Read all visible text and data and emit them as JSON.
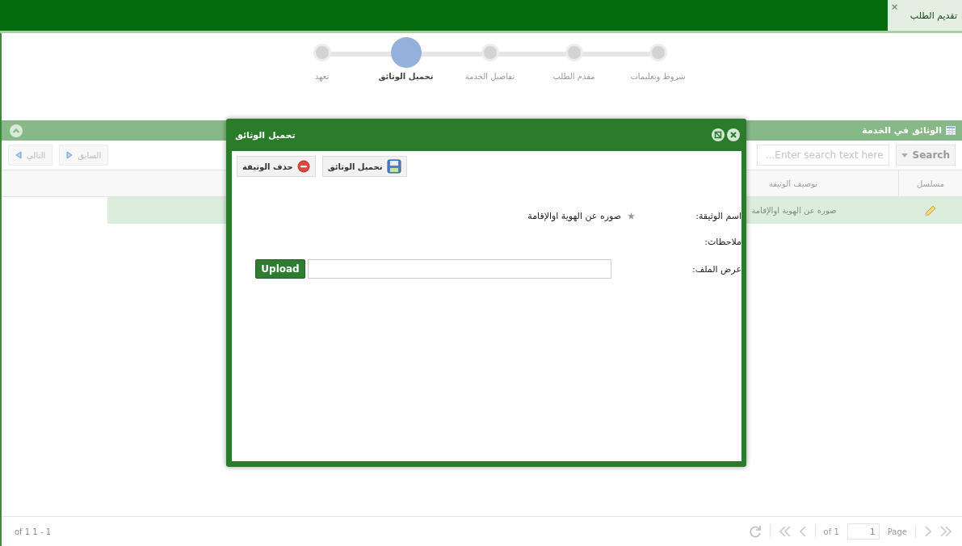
{
  "tab": {
    "label": "تقديم الطلب",
    "close": "×"
  },
  "steps": [
    {
      "label": "شروط وتعليمات",
      "selected": false
    },
    {
      "label": "مقدم الطلب",
      "selected": false
    },
    {
      "label": "تفاصيل الخدمة",
      "selected": false
    },
    {
      "label": "تحميل الوثائق",
      "selected": true
    },
    {
      "label": "تعهد",
      "selected": false
    }
  ],
  "panel": {
    "title": "الوثائق في الخدمة",
    "search_button": "Search",
    "search": {
      "placeholder": "Enter search text here..."
    },
    "nav": [
      {
        "label": "السابق",
        "kind": "prev",
        "disabled": true
      },
      {
        "label": "التالي",
        "kind": "next",
        "disabled": true
      }
    ]
  },
  "table": {
    "columns": [
      "مسلسل",
      "توصيف الوثيقة"
    ],
    "rows": [
      {
        "description": "صوره عن الهوية اوالإقامة",
        "selected": true
      }
    ]
  },
  "pager": {
    "summary": "of 1 1 - 1",
    "of": "of 1",
    "page": "1",
    "page_label": "Page"
  },
  "dialog": {
    "title": "تحميل الوثائق",
    "buttons": [
      {
        "label": "تحميل الوثائق",
        "kind": "save"
      },
      {
        "label": "حذف الوثيقة",
        "kind": "delete"
      }
    ],
    "fields": [
      {
        "label": "اسم الوثيقة:",
        "kind": "text",
        "value": "صوره عن الهوية اوالإقامة",
        "required": true
      },
      {
        "label": "ملاحظات:",
        "kind": "text"
      },
      {
        "label": "عرض الملف:",
        "kind": "file",
        "button": "Upload"
      }
    ]
  }
}
